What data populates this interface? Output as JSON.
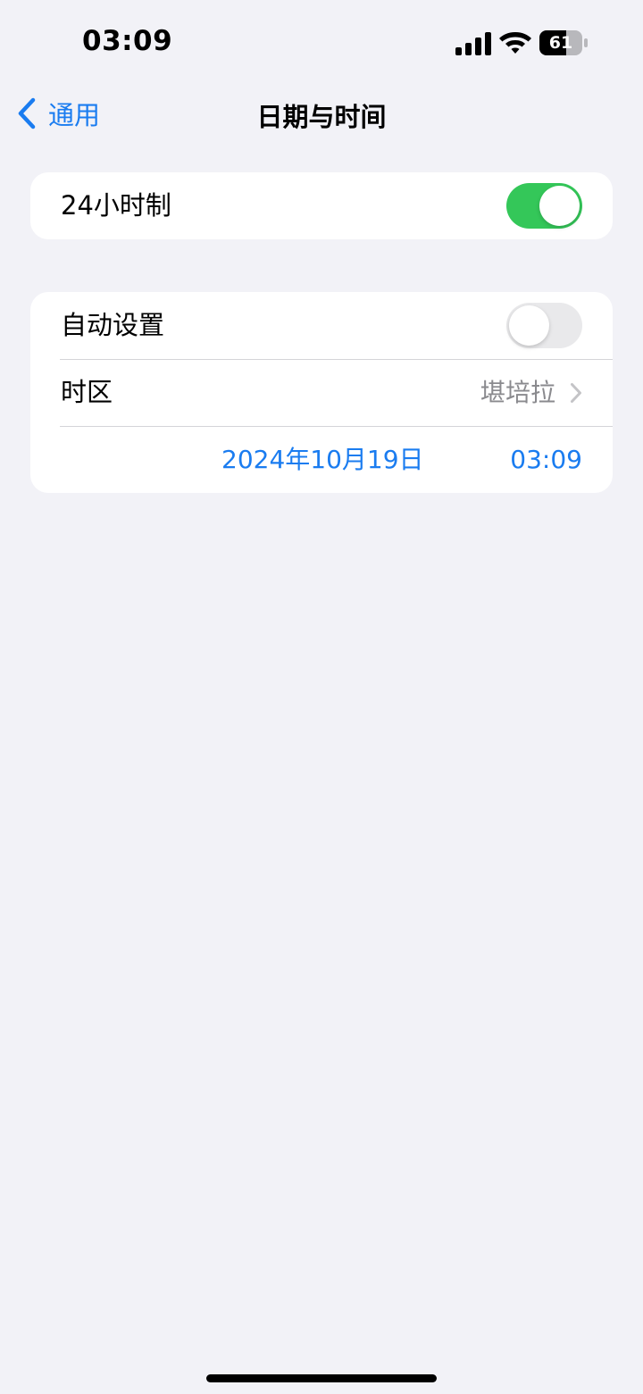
{
  "status_bar": {
    "time": "03:09",
    "battery_level": "61",
    "icons": [
      "signal-icon",
      "wifi-icon",
      "battery-icon"
    ]
  },
  "nav": {
    "back_label": "通用",
    "title": "日期与时间",
    "back_icon": "chevron-left-icon"
  },
  "settings": {
    "hour24": {
      "label": "24小时制",
      "enabled": true
    },
    "auto_set": {
      "label": "自动设置",
      "enabled": false
    },
    "timezone": {
      "label": "时区",
      "value": "堪培拉",
      "icon": "chevron-right-icon"
    },
    "date": "2024年10月19日",
    "time": "03:09"
  },
  "colors": {
    "accent": "#1a7cf0",
    "toggle_on": "#34c759",
    "toggle_off": "#e9e9eb",
    "background": "#f2f2f7",
    "secondary_text": "#8a8a8e"
  }
}
